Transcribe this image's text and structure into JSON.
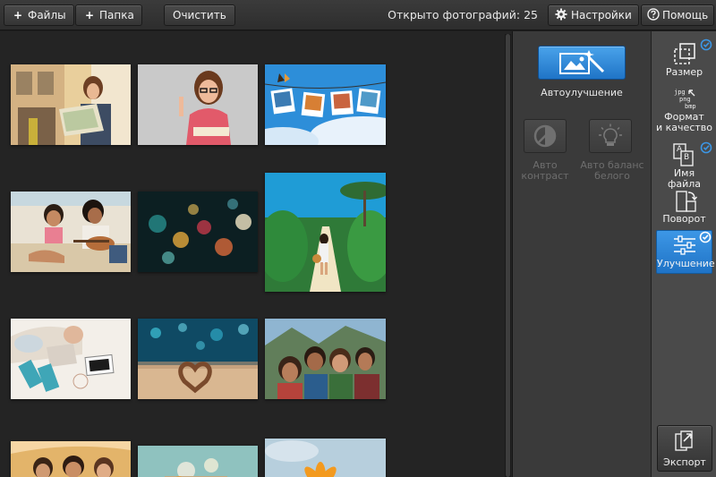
{
  "toolbar": {
    "files_label": "Файлы",
    "folder_label": "Папка",
    "clear_label": "Очистить",
    "photo_count_text": "Открыто фотографий: 25",
    "settings_label": "Настройки",
    "help_label": "Помощь"
  },
  "enhance": {
    "auto_enhance_label": "Автоулучшение",
    "auto_contrast_label_l1": "Авто",
    "auto_contrast_label_l2": "контраст",
    "auto_wb_label_l1": "Авто баланс",
    "auto_wb_label_l2": "белого"
  },
  "tools": {
    "resize_label": "Размер",
    "format_label_l1": "Формат",
    "format_label_l2": "и качество",
    "format_icon_text_1": "jpg",
    "format_icon_text_2": "png",
    "format_icon_text_3": "bmp",
    "filename_label": "Имя файла",
    "filename_icon_letter_a": "A",
    "filename_icon_letter_b": "B",
    "rotate_label": "Поворот",
    "enhance_label": "Улучшение",
    "export_label": "Экспорт"
  },
  "colors": {
    "accent": "#2a86da",
    "panel": "#3a3a3a",
    "gallery_bg": "#242424",
    "toolbar_bg": "#4a4a4a"
  },
  "icons": {
    "files": "plus-icon",
    "folder": "plus-icon",
    "settings": "gear-icon",
    "help": "question-icon",
    "auto_enhance": "magic-wand-image-icon",
    "auto_contrast": "contrast-icon",
    "auto_wb": "lightbulb-icon",
    "resize": "resize-icon",
    "format": "format-conversion-icon",
    "filename": "rename-icon",
    "rotate": "rotate-icon",
    "enhance": "sliders-icon",
    "export": "export-icon",
    "applied": "check-badge-icon"
  }
}
